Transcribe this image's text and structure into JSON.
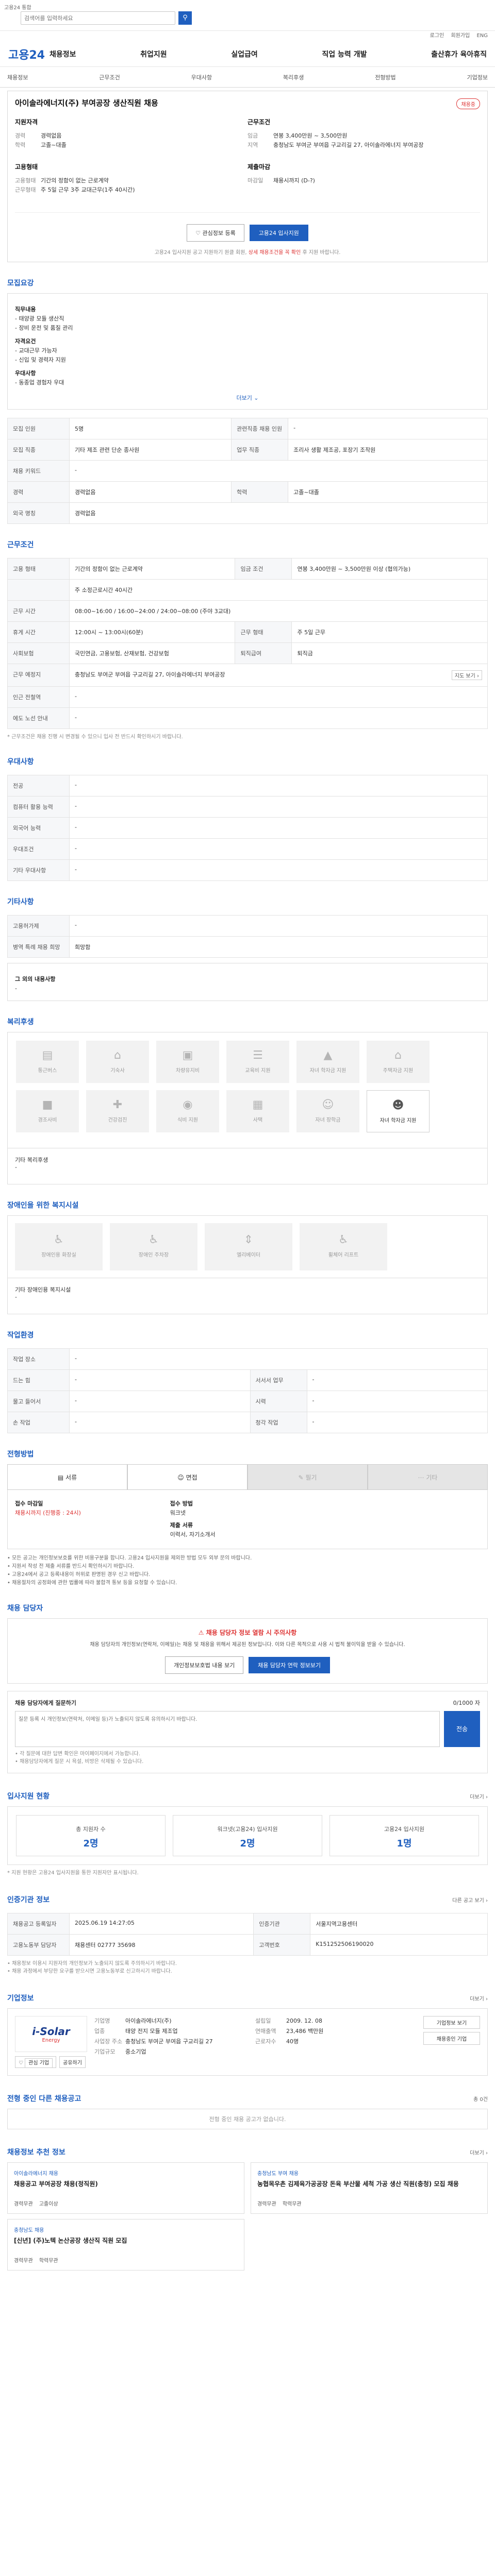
{
  "top": {
    "note": "고용24 통합",
    "search_placeholder": "검색어를 입력하세요",
    "util_links": [
      "로그인",
      "회원가입",
      "ENG"
    ]
  },
  "logo": "고용24",
  "mainnav": [
    "채용정보",
    "취업지원",
    "실업급여",
    "직업 능력 개발",
    "출산휴가 육아휴직"
  ],
  "subnav": [
    "채용정보",
    "근무조건",
    "우대사항",
    "복리후생",
    "전형방법",
    "기업정보"
  ],
  "job": {
    "title": "아이솔라에너지(주) 부여공장 생산직원 채용",
    "badge": "채용중",
    "recruit": {
      "heading": "지원자격",
      "rows": [
        {
          "k": "경력",
          "v": "경력없음"
        },
        {
          "k": "학력",
          "v": "고졸~대졸"
        }
      ]
    },
    "work": {
      "heading": "근무조건",
      "rows": [
        {
          "k": "임금",
          "v": "연봉 3,400만원 ~ 3,500만원"
        },
        {
          "k": "지역",
          "v": "충청남도 부여군 부여읍 구교리길 27, 아이솔라에너지 부여공장"
        }
      ]
    },
    "employ": {
      "heading": "고용형태",
      "rows": [
        {
          "k": "고용형태",
          "v": "기간의 정함이 없는 근로계약"
        },
        {
          "k": "근무형태",
          "v": "주 5일 근무 3주 교대근무(1주 40시간)"
        }
      ]
    },
    "deadline": {
      "heading": "제출마감",
      "rows": [
        {
          "k": "마감일",
          "v": "채용시까지 (D-?)"
        }
      ]
    },
    "btn_interest": "관심정보 등록",
    "btn_apply": "고용24 입사지원",
    "note_prefix": "고용24 입사지원 공고 지원하기 원클 회원, ",
    "note_red": "상세 채용조건을 꼭 확인",
    "note_suffix": " 후 지원 바랍니다."
  },
  "recruit_section": {
    "title": "모집요강",
    "lines": [
      {
        "label": "직무내용",
        "text": ""
      },
      {
        "label": "",
        "text": "- 태양광 모듈 생산직"
      },
      {
        "label": "",
        "text": "- 장비 운전 및 품질 관리"
      },
      {
        "label": "자격요건",
        "text": ""
      },
      {
        "label": "",
        "text": "- 교대근무 가능자"
      },
      {
        "label": "",
        "text": "- 신입 및 경력자 지원"
      },
      {
        "label": "우대사항",
        "text": ""
      },
      {
        "label": "",
        "text": "- 동종업 경험자 우대"
      }
    ],
    "toggle": "더보기 ⌄"
  },
  "recruit_table": [
    [
      {
        "k": "모집 인원",
        "v": "5명"
      },
      {
        "k": "관련직종 채용 인원",
        "v": "-"
      }
    ],
    [
      {
        "k": "모집 직종",
        "v": "기타 제조 관련 단순 종사원"
      },
      {
        "k": "업무 직종",
        "v": "조리사 생활 제조공, 포장기 조작원"
      }
    ],
    [
      {
        "k": "채용 키워드",
        "v": "-"
      },
      {
        "k": "",
        "v": ""
      }
    ],
    [
      {
        "k": "경력",
        "v": "경력없음"
      },
      {
        "k": "학력",
        "v": "고졸~대졸"
      }
    ],
    [
      {
        "k": "외국 명칭",
        "v": "경력없음"
      },
      {
        "k": "",
        "v": ""
      }
    ]
  ],
  "work_section": {
    "title": "근무조건",
    "rows": [
      [
        {
          "k": "고용 형태",
          "v": "기간의 정함이 없는 근로계약"
        },
        {
          "k": "임금 조건",
          "v": "연봉 3,400만원 ~ 3,500만원 이상 (협의가능)"
        }
      ],
      [
        {
          "k": "",
          "v": "주 소정근로시간 40시간"
        },
        {
          "k": "",
          "v": ""
        }
      ],
      [
        {
          "k": "근무 시간",
          "v": "08:00~16:00 / 16:00~24:00 / 24:00~08:00 (주야 3교대)"
        },
        {
          "k": "",
          "v": ""
        }
      ],
      [
        {
          "k": "휴게 시간",
          "v": "12:00시 ~ 13:00시(60분)"
        },
        {
          "k": "근무 형태",
          "v": "주 5일 근무"
        }
      ],
      [
        {
          "k": "사회보험",
          "v": "국민연금, 고용보험, 산재보험, 건강보험"
        },
        {
          "k": "퇴직급여",
          "v": "퇴직금"
        }
      ],
      [
        {
          "k": "근무 예정지",
          "v": "충청남도 부여군 부여읍 구교리길 27, 아이솔라에너지 부여공장"
        },
        {
          "k": "",
          "v": "지도 보기 ›"
        }
      ],
      [
        {
          "k": "인근 전철역",
          "v": "-"
        },
        {
          "k": "",
          "v": ""
        }
      ],
      [
        {
          "k": "에도 노선 안내",
          "v": "-"
        },
        {
          "k": "",
          "v": ""
        }
      ]
    ],
    "note": "* 근무조건은 채용 진행 시 변경될 수 있으니 입사 전 반드시 확인하시기 바랍니다."
  },
  "prefer_section": {
    "title": "우대사항",
    "rows": [
      {
        "k": "전공",
        "v": "-"
      },
      {
        "k": "컴퓨터 활용 능력",
        "v": "-"
      },
      {
        "k": "외국어 능력",
        "v": "-"
      },
      {
        "k": "우대조건",
        "v": "-"
      },
      {
        "k": "기타 우대사항",
        "v": "-"
      }
    ]
  },
  "etc_section": {
    "title": "기타사항",
    "rows": [
      {
        "k": "고용허가제",
        "v": "-"
      },
      {
        "k": "병역 특례 채용 희망",
        "v": "희망함"
      }
    ],
    "extra_label": "그 외의 내용사항",
    "extra_value": "-"
  },
  "welfare_section": {
    "title": "복리후생",
    "row1": [
      "통근버스",
      "기숙사",
      "차량유지비",
      "교육비 지원",
      "자녀 학자금 지원",
      "주택자금 지원"
    ],
    "row2": [
      "경조사비",
      "건강검진",
      "식비 지원",
      "사택",
      "자녀 장학금"
    ],
    "row2_active": "자녀 학자금 지원",
    "detail_label": "기타 복리후생",
    "detail_value": "-"
  },
  "disab_section": {
    "title": "장애인을 위한 복지시설",
    "items": [
      "장애인용 화장실",
      "장애인 주차장",
      "엘리베이터",
      "휠체어 리프트"
    ],
    "detail_label": "기타 장애인용 복지시설",
    "detail_value": "-"
  },
  "work_env": {
    "title": "작업환경",
    "rows": [
      [
        {
          "k": "작업 장소",
          "v": "-"
        },
        {
          "k": "",
          "v": ""
        }
      ],
      [
        {
          "k": "드는 힘",
          "v": "-"
        },
        {
          "k": "서서서 업무",
          "v": "-"
        }
      ],
      [
        {
          "k": "물고 들어서",
          "v": "-"
        },
        {
          "k": "시력",
          "v": "-"
        }
      ],
      [
        {
          "k": "손 작업",
          "v": "-"
        },
        {
          "k": "청각 작업",
          "v": "-"
        }
      ]
    ]
  },
  "selection": {
    "title": "전형방법",
    "tabs": [
      {
        "label": "서류",
        "active": true
      },
      {
        "label": "면접",
        "active": true
      },
      {
        "label": "필기",
        "active": false
      },
      {
        "label": "기타",
        "active": false
      }
    ],
    "docs": {
      "col1_title": "접수 마감일",
      "col1_value": "채용시까지 (진행중 : 24시)",
      "col2_title": "접수 방법",
      "col2_value": "워크넷",
      "col3_title": "제출 서류",
      "col3_value": "이력서, 자기소개서"
    },
    "notes": [
      "• 모든 공고는 개인정보보호를 위한 비용구분을 합니다. 고용24 입사지원을 제외한 방법 모두 외부 문의 바랍니다.",
      "• 지원서 작성 전 제출 서류를 반드시 확인하시기 바랍니다.",
      "• 고용24에서 공고 등록내용이 허위로 판명된 경우 신고 바랍니다.",
      "• 채용절차의 공정화에 관한 법률에 따라 불합격 통보 등을 요청할 수 있습니다."
    ]
  },
  "contact": {
    "title": "채용 담당자",
    "warn": "채용 담당자 정보 열람 시 주의사항",
    "desc": "채용 담당자의 개인정보(연락처, 이메일)는 채용 및 채용을 위해서 제공된 정보입니다. 이와 다른 목적으로 사용 시 법적 불이익을 받을 수 있습니다.",
    "btn_view": "개인정보보호법 내용 보기",
    "btn_info": "채용 담당자 연락 정보보기",
    "qna_title": "채용 담당자에게 질문하기",
    "qna_right": "0/1000 자",
    "qna_placeholder": "질문 등록 시 개인정보(연락처, 이메일 등)가 노출되지 않도록 유의하시기 바랍니다.",
    "qna_send": "전송",
    "qna_foot1": "• 각 질문에 대한 답변 확인은 마이페이지에서 가능합니다.",
    "qna_foot2": "• 채용담당자에게 질문 시 욕설, 비방은 삭제될 수 있습니다."
  },
  "stats": {
    "title": "입사지원 현황",
    "more": "더보기 ›",
    "items": [
      {
        "label": "총 지원자 수",
        "value": "2명"
      },
      {
        "label": "워크넷(고용24) 입사지원",
        "value": "2명"
      },
      {
        "label": "고용24 입사지원",
        "value": "1명"
      }
    ],
    "note": "* 지원 현황은 고용24 입사지원을 통한 지원자만 표시됩니다."
  },
  "agency": {
    "title": "인증기관 정보",
    "more": "다른 공고 보기 ›",
    "rows": [
      [
        {
          "k": "채용공고 등록일자",
          "v": "2025.06.19 14:27:05"
        },
        {
          "k": "인증기관",
          "v": "서울지역고용센터"
        }
      ],
      [
        {
          "k": "고용노동부 담당자",
          "v": "채용센터 02777 35698"
        },
        {
          "k": "고객번호",
          "v": "K151252506190020"
        }
      ]
    ],
    "notes": [
      "• 채용정보 이용시 지원자의 개인정보가 노출되지 않도록 주의하시기 바랍니다.",
      "• 채용 과정에서 부당한 요구를 받으시면 고용노동부로 신고하시기 바랍니다."
    ]
  },
  "company": {
    "title": "기업정보",
    "more": "더보기 ›",
    "logo_text": "i-Solar",
    "logo_sub": "Energy",
    "left": [
      {
        "k": "기업명",
        "v": "아이솔라에너지(주)"
      },
      {
        "k": "업종",
        "v": "태양 전지 모듈 제조업"
      },
      {
        "k": "사업장 주소",
        "v": "충청남도 부여군 부여읍 구교리길 27"
      },
      {
        "k": "기업규모",
        "v": "중소기업"
      }
    ],
    "right": [
      {
        "k": "설립일",
        "v": "2009. 12. 08"
      },
      {
        "k": "연매출액",
        "v": "23,486 백만원"
      },
      {
        "k": "근로자수",
        "v": "40명"
      }
    ],
    "side_btn1": "기업정보 보기",
    "side_btn2": "채용중인 기업",
    "btn_save": "관심 기업",
    "btn_share": "공유하기"
  },
  "other_jobs": {
    "title": "전형 중인 다른 채용공고",
    "more": "총 0건",
    "empty": "전형 중인 채용 공고가 없습니다."
  },
  "recommend": {
    "title": "채용정보 추천 정보",
    "more": "더보기 ›",
    "cards": [
      {
        "tag": "아이솔라에너지 채용",
        "title": "채용공고 부여공장 채용(정직원)",
        "meta1": "경력무관",
        "meta2": "고졸이상"
      },
      {
        "tag": "충청남도 부여 채용",
        "title": "농협목우촌 김제육가공공장 돈육 부산물 세척 가공 생산 직원(충청) 모집 채용",
        "meta1": "경력무관",
        "meta2": "학력무관"
      }
    ],
    "card3": {
      "tag": "충청남도 채용",
      "title": "[신년] (주)노텍 논산공장 생산직 직원 모집",
      "meta1": "경력무관",
      "meta2": "학력무관"
    }
  }
}
